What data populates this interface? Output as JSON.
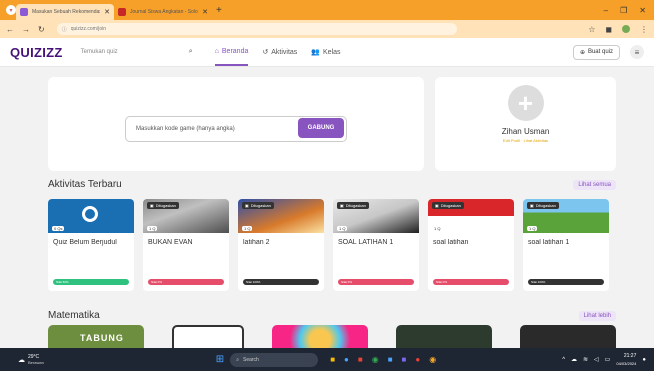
{
  "browser": {
    "tabs": [
      {
        "title": "Masukan Sebuah Rekomendasi Kuis",
        "active": true
      },
      {
        "title": "Journal Siswa Angkatan - Solomon",
        "active": false
      }
    ],
    "url": "quizizz.com/join"
  },
  "nav": {
    "logo": "QUIZIZZ",
    "search_placeholder": "Temukan quiz",
    "links": [
      {
        "label": "Beranda",
        "icon": "home-icon"
      },
      {
        "label": "Aktivitas",
        "icon": "history-icon"
      },
      {
        "label": "Kelas",
        "icon": "people-icon"
      }
    ],
    "create_label": "Buat quiz"
  },
  "join": {
    "placeholder": "Masukkan kode game (hanya angka)",
    "button": "GABUNG"
  },
  "profile": {
    "name": "Zihan Usman",
    "sub": "Edit Profil · Lihat Aktivitas"
  },
  "recent": {
    "title": "Aktivitas Terbaru",
    "see_all": "Lihat semua",
    "cards": [
      {
        "title": "Quiz Belum Berjudul",
        "badge": "",
        "count": "0 Qs",
        "score": "Nilai 60%",
        "score_color": "#2ec27e",
        "thumb": "blue"
      },
      {
        "title": "BUKAN EVAN",
        "badge": "Ditugaskan",
        "count": "1 Q",
        "score": "Nilai 0%",
        "score_color": "#e54d6a",
        "thumb": "img1"
      },
      {
        "title": "latihan 2",
        "badge": "Ditugaskan",
        "count": "1 Q",
        "score": "Nilai 100%",
        "score_color": "#333333",
        "thumb": "img2"
      },
      {
        "title": "SOAL LATIHAN 1",
        "badge": "Ditugaskan",
        "count": "1 Q",
        "score": "Nilai 0%",
        "score_color": "#e54d6a",
        "thumb": "img3"
      },
      {
        "title": "soal latihan",
        "badge": "Ditugaskan",
        "count": "1 Q",
        "score": "Nilai 0%",
        "score_color": "#e54d6a",
        "thumb": "img4"
      },
      {
        "title": "soal latihan 1",
        "badge": "Ditugaskan",
        "count": "1 Q",
        "score": "Nilai 100%",
        "score_color": "#333333",
        "thumb": "img5"
      }
    ]
  },
  "math": {
    "title": "Matematika",
    "see_more": "Lihat lebih",
    "first_label": "TABUNG"
  },
  "taskbar": {
    "temp": "29°C",
    "weather": "Berawan",
    "search": "Search",
    "time": "21:27",
    "date": "04/03/2024"
  }
}
